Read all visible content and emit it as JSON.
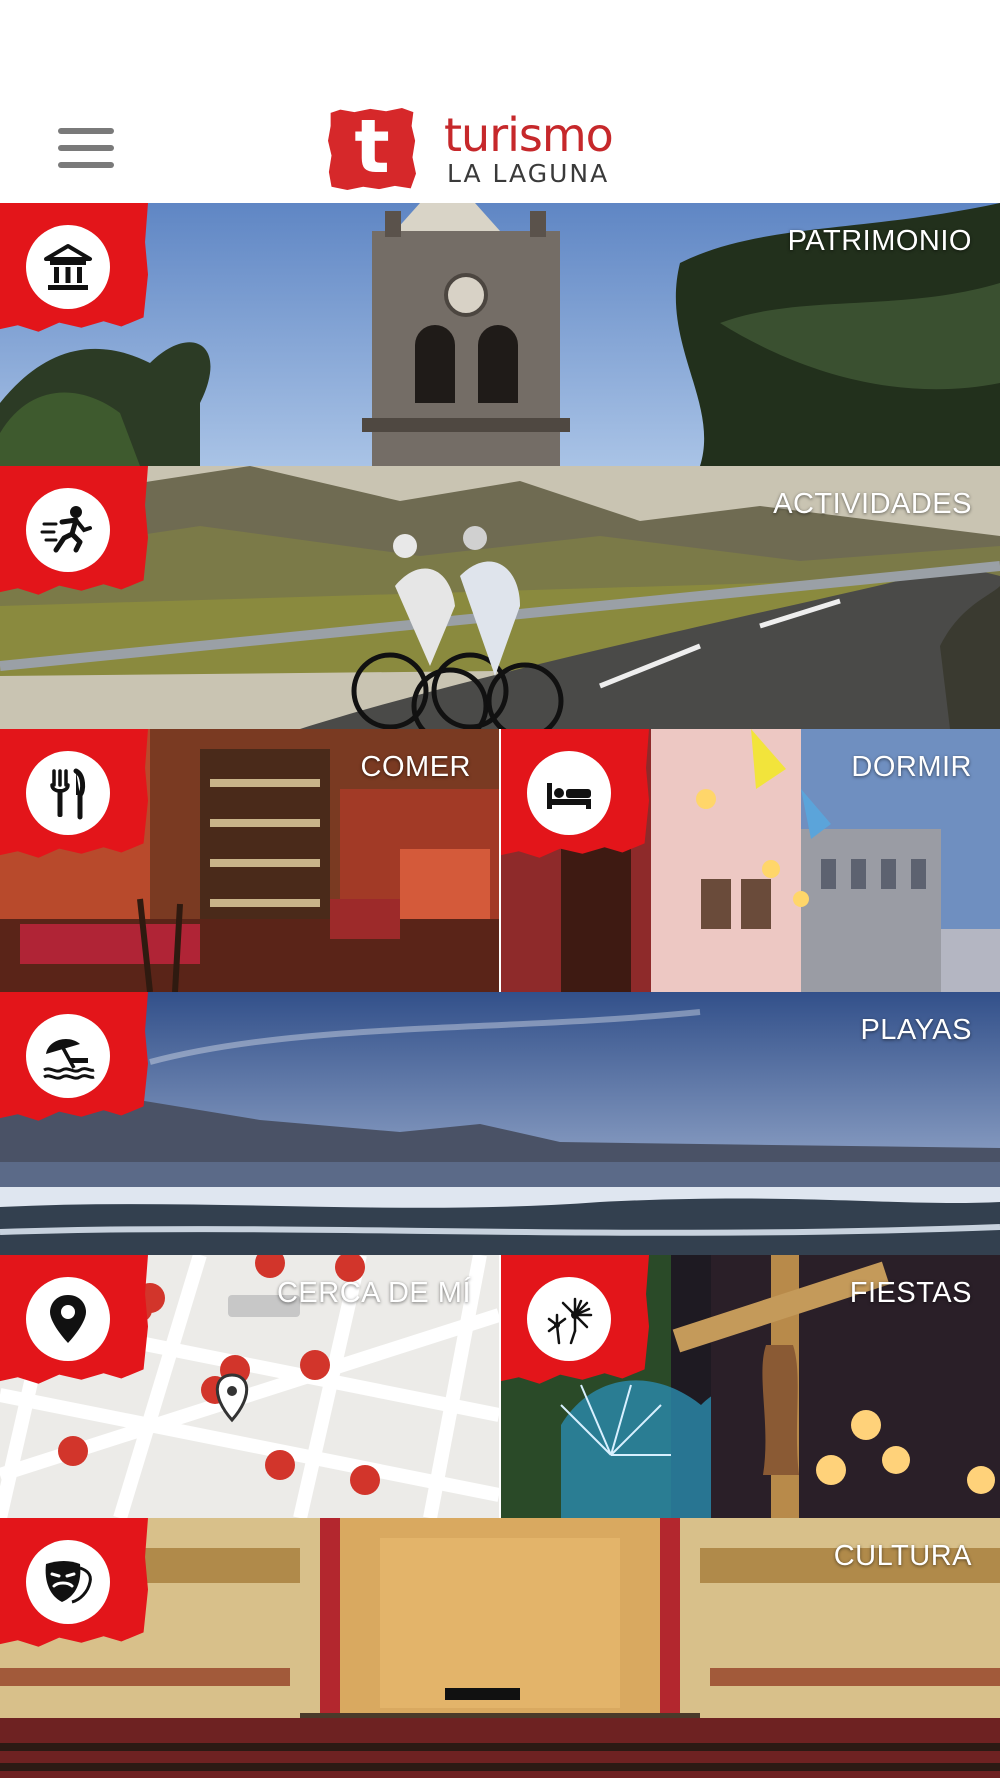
{
  "header": {
    "menu_icon": "hamburger-menu-icon",
    "logo_letter": "t",
    "logo_word": "turismo",
    "logo_subtitle": "LA LAGUNA",
    "brand_color": "#c6282b"
  },
  "tiles": [
    {
      "label": "PATRIMONIO",
      "icon": "heritage-building-icon"
    },
    {
      "label": "ACTIVIDADES",
      "icon": "running-person-icon"
    },
    {
      "label": "COMER",
      "icon": "fork-knife-icon"
    },
    {
      "label": "DORMIR",
      "icon": "bed-icon"
    },
    {
      "label": "PLAYAS",
      "icon": "beach-umbrella-icon"
    },
    {
      "label": "CERCA DE MÍ",
      "icon": "location-pin-icon"
    },
    {
      "label": "FIESTAS",
      "icon": "fireworks-icon"
    },
    {
      "label": "CULTURA",
      "icon": "theater-mask-icon"
    }
  ],
  "colors": {
    "badge": "#e3151a"
  }
}
